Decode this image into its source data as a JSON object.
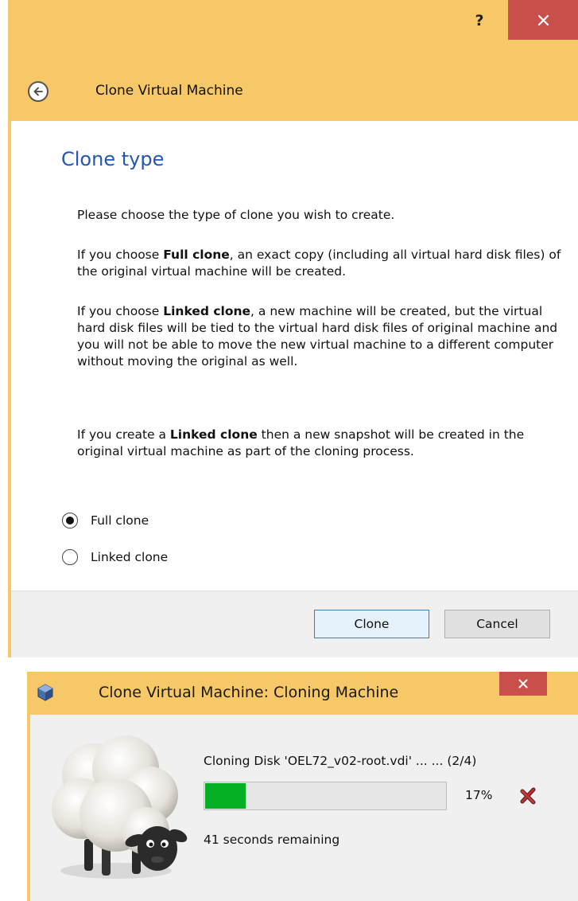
{
  "dialog1": {
    "title": "Clone Virtual Machine",
    "help_label": "?",
    "heading": "Clone type",
    "intro": "Please choose the type of clone you wish to create.",
    "full_para": {
      "prefix": "If you choose ",
      "bold": "Full clone",
      "suffix": ", an exact copy (including all virtual hard disk files) of the original virtual machine will be created."
    },
    "linked_para": {
      "prefix": "If you choose ",
      "bold": "Linked clone",
      "suffix": ", a new machine will be created, but the virtual hard disk files will be tied to the virtual hard disk files of original machine and you will not be able to move the new virtual machine to a different computer without moving the original as well."
    },
    "snapshot_para": {
      "prefix": "If you create a ",
      "bold": "Linked clone",
      "suffix": " then a new snapshot will be created in the original virtual machine as part of the cloning process."
    },
    "options": [
      {
        "label": "Full clone",
        "selected": true
      },
      {
        "label": "Linked clone",
        "selected": false
      }
    ],
    "clone_button": "Clone",
    "cancel_button": "Cancel"
  },
  "dialog2": {
    "title": "Clone Virtual Machine: Cloning Machine",
    "status": "Cloning Disk 'OEL72_v02-root.vdi' ... ... (2/4)",
    "progress": 0.17,
    "percent": "17%",
    "remaining": "41 seconds remaining"
  },
  "colors": {
    "title_bar": "#f6c868",
    "close_button": "#c9504a",
    "heading_blue": "#2457b4",
    "progress_green": "#06b025"
  }
}
